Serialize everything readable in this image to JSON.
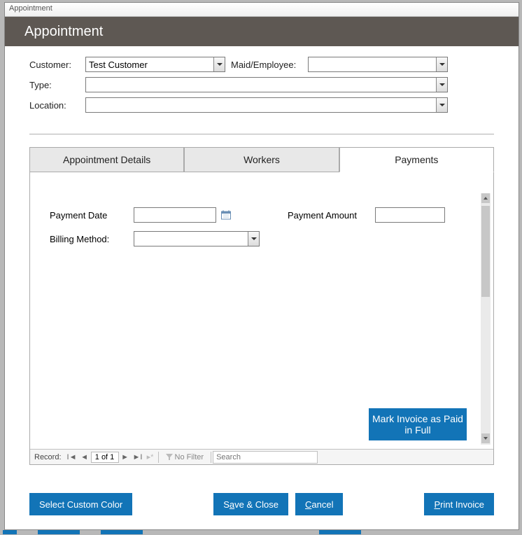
{
  "window": {
    "title": "Appointment"
  },
  "header": {
    "title": "Appointment"
  },
  "form": {
    "customer_label": "Customer:",
    "customer_value": "Test Customer",
    "employee_label": "Maid/Employee:",
    "employee_value": "",
    "type_label": "Type:",
    "type_value": "",
    "location_label": "Location:",
    "location_value": ""
  },
  "tabs": {
    "details": "Appointment Details",
    "workers": "Workers",
    "payments": "Payments"
  },
  "payments": {
    "date_label": "Payment Date",
    "date_value": "",
    "amount_label": "Payment Amount",
    "amount_value": "",
    "billing_label": "Billing Method:",
    "billing_value": "",
    "mark_button": "Mark Invoice as Paid in Full"
  },
  "recordnav": {
    "label": "Record:",
    "position": "1 of 1",
    "filter": "No Filter",
    "search_placeholder": "Search"
  },
  "buttons": {
    "select_color": "Select Custom Color",
    "save_close_pre": "S",
    "save_close_ul": "a",
    "save_close_post": "ve & Close",
    "cancel_ul": "C",
    "cancel_post": "ancel",
    "print_ul": "P",
    "print_post": "rint Invoice"
  }
}
